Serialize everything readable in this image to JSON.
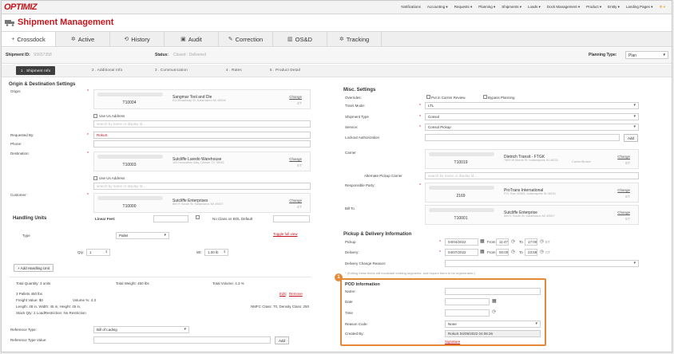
{
  "app": {
    "logo": "OPTIMIZ"
  },
  "topnav": {
    "items": [
      "Notifications",
      "Accounting ▾",
      "Requests ▾",
      "Planning ▾",
      "Shipments ▾",
      "Loads ▾",
      "Dock Management ▾",
      "Product ▾",
      "Entity ▾",
      "Landing Pages ▾"
    ],
    "settings_icon": "gear-icon"
  },
  "page": {
    "title": "Shipment Management",
    "icon": "truck-icon"
  },
  "tabs": [
    {
      "label": "Crossdock",
      "icon": "+"
    },
    {
      "label": "Active",
      "icon": "✲"
    },
    {
      "label": "History",
      "icon": "⟲"
    },
    {
      "label": "Audit",
      "icon": "▣"
    },
    {
      "label": "Correction",
      "icon": "✎"
    },
    {
      "label": "OS&D",
      "icon": "▥"
    },
    {
      "label": "Tracking",
      "icon": "✲"
    }
  ],
  "shipment": {
    "id_label": "Shipment ID:",
    "id_value": "S5657358",
    "status_label": "Status:",
    "status_value": "Closed : Delivered",
    "planning_type_label": "Planning Type:",
    "planning_type_value": "Plan"
  },
  "steps": [
    "1 . Shipment Info",
    "2 . Additional Info",
    "3 . Communication",
    "4 . Rates",
    "5 . Product Detail"
  ],
  "origin_dest": {
    "heading": "Origin & Destination Settings",
    "origin_label": "Origin:",
    "origin": {
      "id_caption": "Shipper",
      "number": "T10004",
      "name": "Sangmar Tool and Die",
      "address": "811 Broadway St, Kalamazoo MI 49008",
      "change": "Change",
      "tz": "ET"
    },
    "use_us_address": "Use Us Address",
    "search_placeholder": "search by name or display id...",
    "requested_by_label": "Requested By:",
    "requested_by_value": "RokuS",
    "phone_label": "Phone:",
    "destination_label": "Destination:",
    "destination": {
      "id_caption": "Vendor",
      "number": "T10003",
      "name": "Sutcliffe Laredo Warehouse",
      "address": "100 Innovation Way, Laredo TX 78045",
      "change": "Change",
      "tz": "ET"
    },
    "customer_label": "Customer:",
    "customer": {
      "id_caption": "Customer",
      "number": "T10000",
      "name": "Sutcliffe Enterprises",
      "address": "890 E South St, Kalamazoo MI 49007",
      "change": "Change",
      "tz": "ET"
    }
  },
  "handling": {
    "heading": "Handling Units",
    "linear_feet_label": "Linear Feet:",
    "no_class_label": "No Class on BOL Default",
    "type_label": "Type",
    "type_value": "Pallet",
    "toggle_link": "Toggle full view",
    "qty_label": "Qty:",
    "qty_value": "1",
    "wt_label": "Wt:",
    "wt_value": "1.00 lb",
    "add_button": "+ Add Handling Unit",
    "total_qty": "Total Quantity: 3 units",
    "total_weight": "Total Weight: 450 lbs",
    "total_volume": "Total Volume: 4.3 %",
    "line1": "3 Pallets 450 lbs",
    "line2a": "Freight Value: $0",
    "line2b": "Volume %: 4.3",
    "line3": "Length: 48 in, Width: 45 in, Height: 45 in,",
    "line3b": "NMFC Class: 70, Density Class: 250",
    "line4": "Stack Qty: 2 LoadRestriction: No Restriction",
    "edit": "Edit",
    "remove": "Remove",
    "ref_type_label": "Reference Type:",
    "ref_type_value": "Bill of Lading",
    "ref_value_label": "Reference Type Value:",
    "add_label": "Add"
  },
  "misc": {
    "heading": "Misc. Settings",
    "overrides_label": "Overrides:",
    "carrier_review": "Put in Carrier Review",
    "bypass_planning": "Bypass Planning",
    "trans_mode_label": "Trans Mode:",
    "trans_mode_value": "LTL",
    "shipment_type_label": "Shipment Type",
    "shipment_type_value": "Consol",
    "service_label": "Service:",
    "service_value": "Consol Pickup",
    "lockout_label": "Lockout Authorization",
    "add_label": "Add",
    "carrier_label": "Carrier",
    "carrier": {
      "id_caption": "Carrier",
      "number": "T10019",
      "name": "Dietrich Transit - FTGK",
      "address": "7800 W Morris St, Indianapolis IN 46231",
      "note": "Carrier/Broker",
      "change": "Change",
      "tz": "ET"
    },
    "alt_pickup_label": "Alternate Pickup Carrier",
    "alt_placeholder": "search by name or display id...",
    "resp_party_label": "Responsible Party:",
    "resp_party": {
      "id_caption": "Payment Party",
      "number": "2169",
      "name": "ProTrans International",
      "address": "P.O. Box 42069, Indianapolis IN 46241",
      "change": "Change",
      "tz": "ET"
    },
    "bill_to_label": "Bill To",
    "bill_to": {
      "id_caption": "Billto",
      "number": "T10001",
      "name": "Sutcliffe Enterprise",
      "address": "890 E South St, Kalamazoo MI 49007",
      "change": "Change",
      "tz": "ET"
    }
  },
  "pickup": {
    "heading": "Pickup & Delivery Information",
    "pickup_label": "Pickup",
    "pickup_date": "04/04/2022",
    "pickup_from": "11:47",
    "pickup_to": "17:00",
    "pickup_tz": "ET",
    "delivery_label": "Delivery:",
    "delivery_date": "04/07/2022",
    "delivery_from": "00:00",
    "delivery_to": "23:59",
    "delivery_tz": "CT",
    "from_label": "From",
    "to_label": "To",
    "change_reason_label": "Delivery Change Reason:",
    "warning": "* (Editing these fields will invalidate existing segments, and require them to be regenerated.)"
  },
  "pod": {
    "badge": "1",
    "heading": "POD Information",
    "name_label": "Name:",
    "date_label": "Date",
    "time_label": "Time",
    "reason_label": "Reason Code:",
    "reason_value": "None",
    "created_label": "Created By:",
    "created_value": "RokuS 04/08/2022 04:06:26",
    "signature": "Signature"
  }
}
